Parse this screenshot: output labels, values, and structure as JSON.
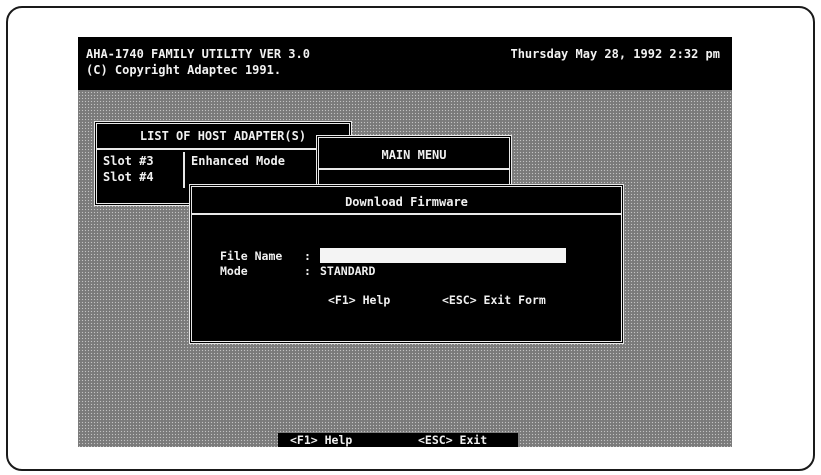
{
  "header": {
    "line1": "AHA-1740 FAMILY UTILITY  VER 3.0",
    "line2": "(C) Copyright Adaptec 1991.",
    "datetime": "Thursday  May 28, 1992  2:32 pm"
  },
  "host_adapters": {
    "title": "LIST OF HOST ADAPTER(S)",
    "slots": [
      "Slot #3",
      "Slot #4"
    ],
    "mode": "Enhanced Mode"
  },
  "main_menu": {
    "title": "MAIN MENU"
  },
  "download_firmware": {
    "title": "Download Firmware",
    "file_name_label": "File Name",
    "file_name_value": "",
    "mode_label": "Mode",
    "mode_value": "STANDARD",
    "colon": ":",
    "help_hint": "<F1> Help",
    "exit_hint": "<ESC> Exit Form"
  },
  "footer": {
    "help_hint": "<F1> Help",
    "exit_hint": "<ESC> Exit"
  }
}
